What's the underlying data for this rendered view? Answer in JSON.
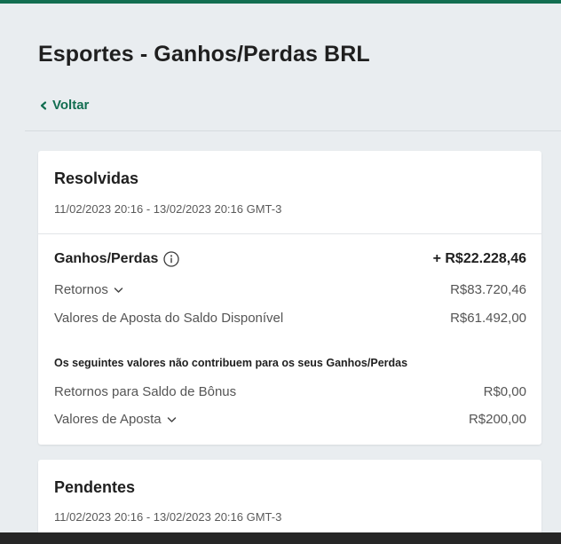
{
  "colors": {
    "accent": "#126e51",
    "background": "#e9edf0",
    "card": "#ffffff"
  },
  "header": {
    "title": "Esportes - Ganhos/Perdas BRL",
    "back_label": "Voltar",
    "back_icon": "chevron-left-icon"
  },
  "settled": {
    "title": "Resolvidas",
    "range": "11/02/2023 20:16 - 13/02/2023 20:16 GMT-3",
    "profit_loss": {
      "label": "Ganhos/Perdas",
      "value": "+ R$22.228,46",
      "icon": "info-icon"
    },
    "returns": {
      "label": "Retornos",
      "value": "R$83.720,46"
    },
    "stakes_available": {
      "label": "Valores de Aposta do Saldo Disponível",
      "value": "R$61.492,00"
    },
    "note": "Os seguintes valores não contribuem para os seus Ganhos/Perdas",
    "bonus_returns": {
      "label": "Retornos para Saldo de Bônus",
      "value": "R$0,00"
    },
    "stakes": {
      "label": "Valores de Aposta",
      "value": "R$200,00"
    }
  },
  "pending": {
    "title": "Pendentes",
    "range": "11/02/2023 20:16 - 13/02/2023 20:16 GMT-3"
  }
}
